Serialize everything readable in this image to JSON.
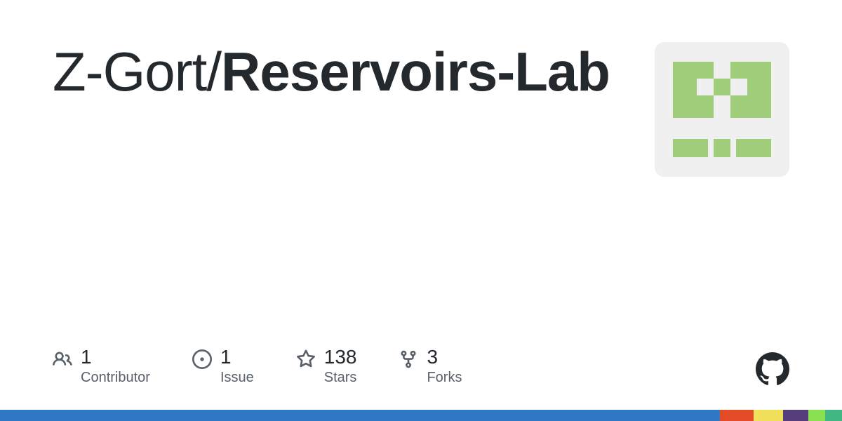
{
  "repo": {
    "owner": "Z-Gort",
    "separator": "/",
    "name_bold": "Reservoirs",
    "name_suffix": "-Lab"
  },
  "stats": {
    "contributors": {
      "value": "1",
      "label": "Contributor"
    },
    "issues": {
      "value": "1",
      "label": "Issue"
    },
    "stars": {
      "value": "138",
      "label": "Stars"
    },
    "forks": {
      "value": "3",
      "label": "Forks"
    }
  },
  "languages": [
    {
      "color": "#3178c6",
      "width": "85.5%"
    },
    {
      "color": "#e34c26",
      "width": "4%"
    },
    {
      "color": "#f1e05a",
      "width": "3.5%"
    },
    {
      "color": "#563d7c",
      "width": "3%"
    },
    {
      "color": "#89e051",
      "width": "2%"
    },
    {
      "color": "#41b883",
      "width": "2%"
    }
  ]
}
